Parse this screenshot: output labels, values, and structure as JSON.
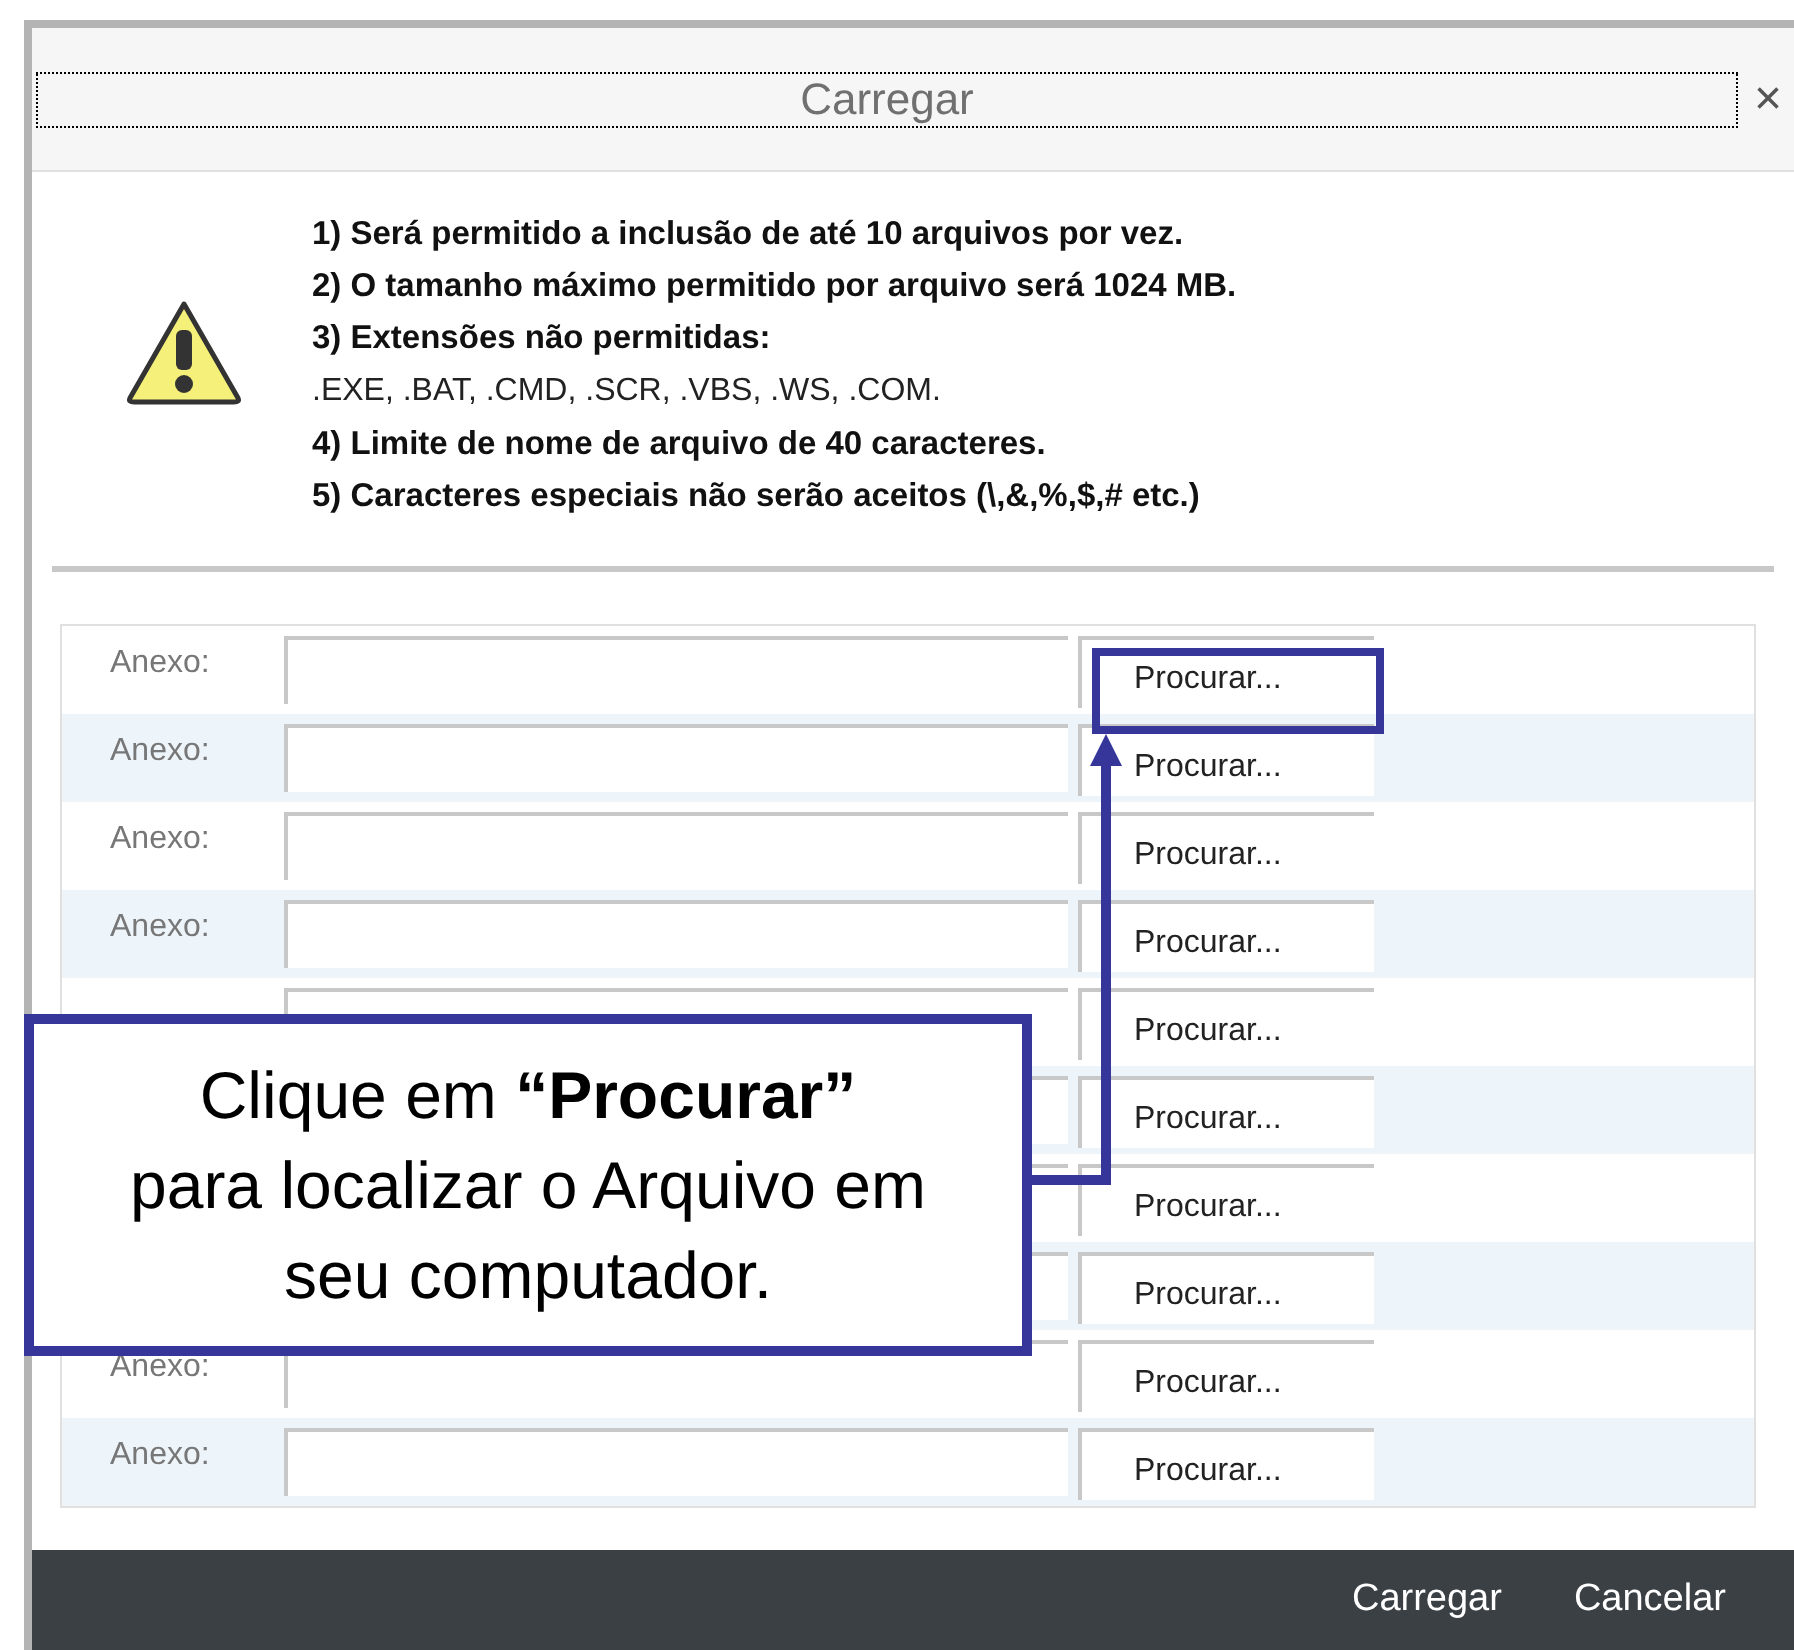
{
  "dialog": {
    "title": "Carregar",
    "close": "×"
  },
  "rules": [
    "1) Será permitido a inclusão de até 10 arquivos por vez.",
    "2) O tamanho máximo permitido por arquivo será 1024 MB.",
    "3) Extensões não permitidas:",
    ".EXE, .BAT, .CMD, .SCR, .VBS, .WS, .COM.",
    "4) Limite de nome de arquivo de 40 caracteres.",
    "5) Caracteres especiais não serão aceitos (\\,&,%,$,# etc.)"
  ],
  "rows": [
    {
      "label": "Anexo:",
      "button": "Procurar..."
    },
    {
      "label": "Anexo:",
      "button": "Procurar..."
    },
    {
      "label": "Anexo:",
      "button": "Procurar..."
    },
    {
      "label": "Anexo:",
      "button": "Procurar..."
    },
    {
      "button": "Procurar..."
    },
    {
      "button": "Procurar..."
    },
    {
      "button": "Procurar..."
    },
    {
      "button": "Procurar..."
    },
    {
      "label": "Anexo:",
      "button": "Procurar..."
    },
    {
      "label": "Anexo:",
      "button": "Procurar..."
    }
  ],
  "footer_buttons": [
    "Carregar",
    "Cancelar"
  ],
  "callout": {
    "text": "Clique em **“Procurar”**\npara localizar o Arquivo em\nseu computador."
  }
}
